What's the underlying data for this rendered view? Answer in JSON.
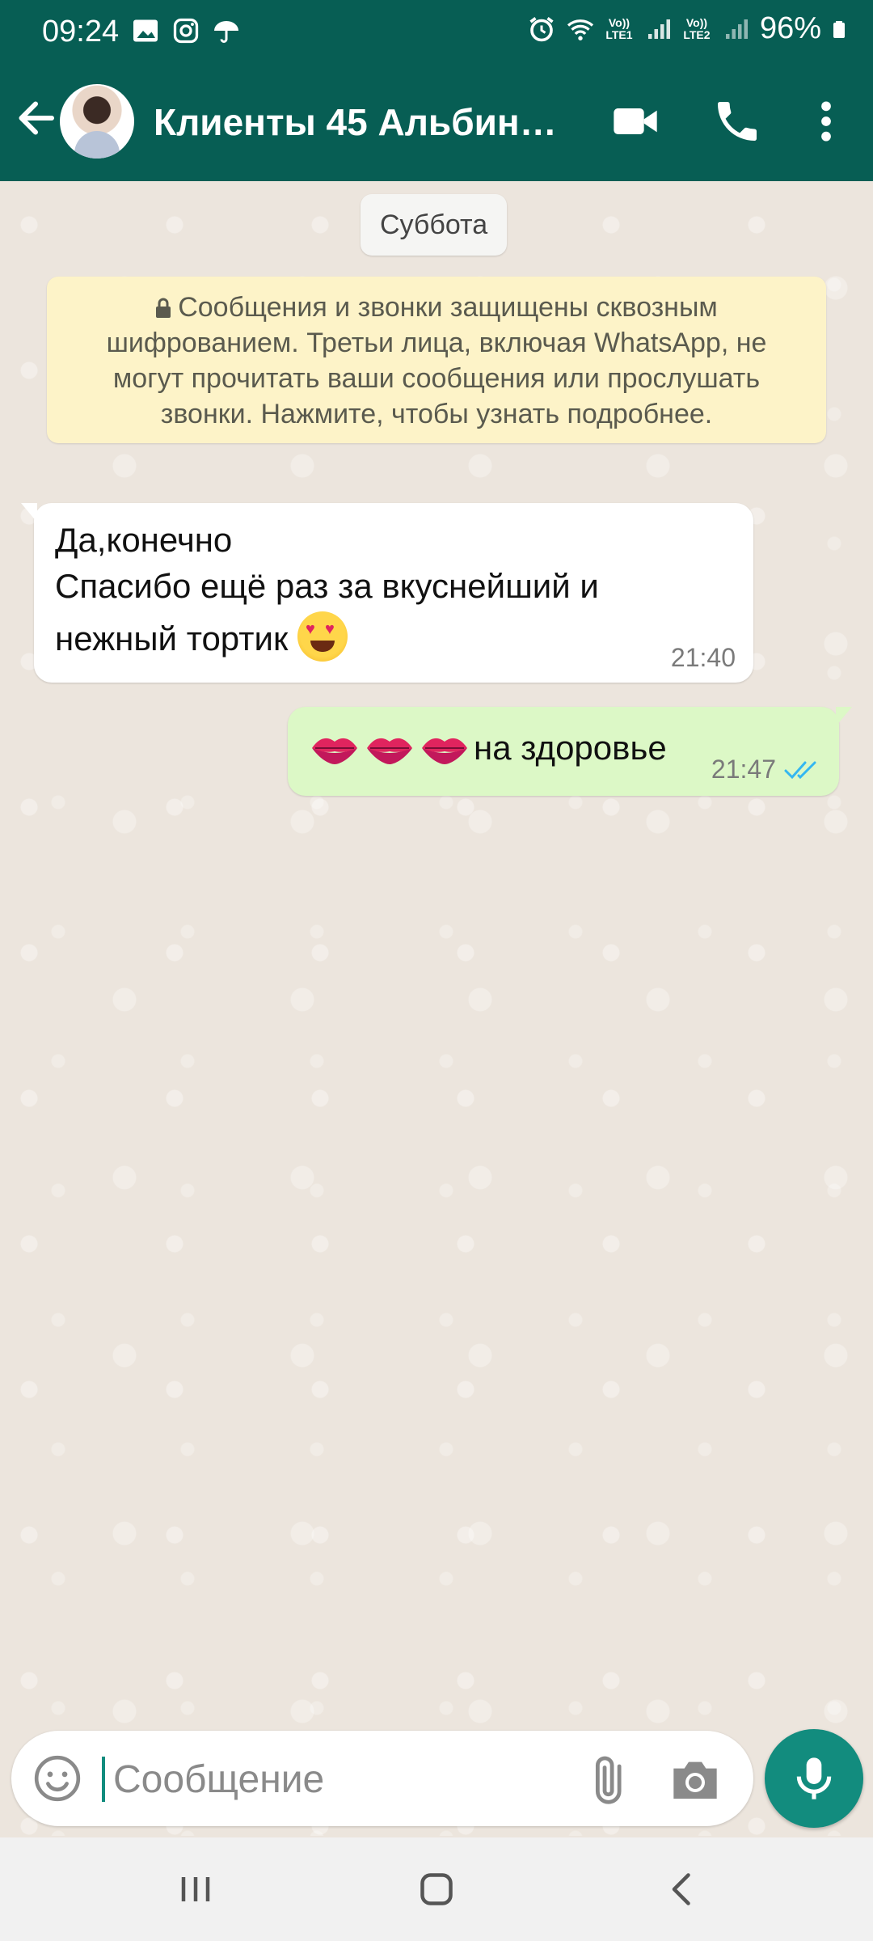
{
  "status_bar": {
    "time": "09:24",
    "battery": "96%",
    "sim1_label": "Vo)) LTE1",
    "sim2_label": "Vo)) LTE2",
    "icons_left": [
      "gallery-icon",
      "instagram-icon",
      "umbrella-icon"
    ],
    "icons_right": [
      "alarm-icon",
      "wifi-icon",
      "signal-icon",
      "battery-icon"
    ]
  },
  "header": {
    "title": "Клиенты 45 Альбина…",
    "actions": [
      "video-call-icon",
      "voice-call-icon",
      "more-menu-icon"
    ],
    "color": "#075e54"
  },
  "chat": {
    "date_label": "Суббота",
    "encryption_notice": "Сообщения и звонки защищены сквозным шифрованием. Третьи лица, включая WhatsApp, не могут прочитать ваши сообщения или прослушать звонки. Нажмите, чтобы узнать подробнее.",
    "messages": [
      {
        "direction": "incoming",
        "line1": "Да,конечно",
        "line2": "Спасибо ещё раз за вкуснейший и",
        "line3": "нежный тортик",
        "emoji": "😍",
        "time": "21:40"
      },
      {
        "direction": "outgoing",
        "emoji_prefix": "💋💋💋",
        "text": "на здоровье",
        "time": "21:47",
        "status": "read"
      }
    ]
  },
  "composer": {
    "placeholder": "Сообщение",
    "accent": "#128c7e"
  },
  "colors": {
    "chat_bg": "#ece5dd",
    "outgoing_bubble": "#dcf8c6",
    "notice_bg": "#fdf3c8",
    "read_ticks": "#34b7f1"
  }
}
